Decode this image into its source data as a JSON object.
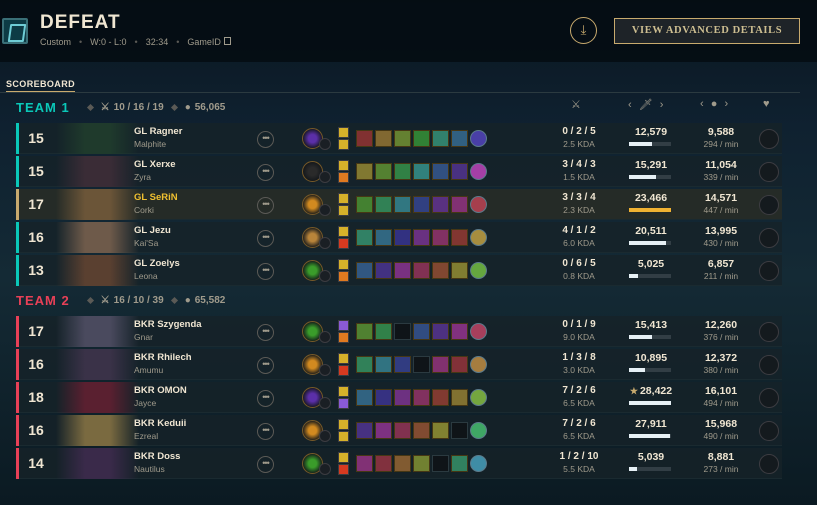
{
  "header": {
    "title": "DEFEAT",
    "queue": "Custom",
    "record": "W:0 - L:0",
    "duration": "32:34",
    "game_id_label": "GameID",
    "download_icon": "download-icon",
    "advanced_button": "VIEW ADVANCED DETAILS"
  },
  "tab": {
    "label": "SCOREBOARD"
  },
  "colors": {
    "team1": "#0ac8b9",
    "team2": "#e84057",
    "accent": "#c8aa6e",
    "text": "#f0e6d2",
    "muted": "#a09b8c"
  },
  "columns": {
    "kda_icon": "crossed-swords-icon",
    "damage_icon": "sword-icon",
    "gold_icon": "gold-coins-icon",
    "honor_icon": "heart-icon",
    "nav_left": "‹",
    "nav_right": "›"
  },
  "teams": [
    {
      "name": "TEAM 1",
      "kda": "10 / 16 / 19",
      "gold": "56,065",
      "players": [
        {
          "level": "15",
          "player": "GL Ragner",
          "champion": "Malphite",
          "kda": "0 / 2 / 5",
          "kda_ratio": "2.5 KDA",
          "damage": "12,579",
          "damage_share": 0.54,
          "gold": "9,588",
          "gpm": "294 / min",
          "highlight": false,
          "mvp": false,
          "items": [
            1,
            1,
            1,
            1,
            1,
            1,
            1
          ],
          "champ_color": "#1f3a2c",
          "rune_color": "#5b2fa8",
          "spell_colors": [
            "#d6b12a",
            "#d6b12a"
          ]
        },
        {
          "level": "15",
          "player": "GL Xerxe",
          "champion": "Zyra",
          "kda": "3 / 4 / 3",
          "kda_ratio": "1.5 KDA",
          "damage": "15,291",
          "damage_share": 0.65,
          "gold": "11,054",
          "gpm": "339 / min",
          "highlight": false,
          "mvp": false,
          "items": [
            1,
            1,
            1,
            1,
            1,
            1,
            1
          ],
          "champ_color": "#3a2c36",
          "rune_color": "#2a2a2a",
          "spell_colors": [
            "#d6b12a",
            "#e07a20"
          ]
        },
        {
          "level": "17",
          "player": "GL SeRiN",
          "champion": "Corki",
          "kda": "3 / 3 / 4",
          "kda_ratio": "2.3 KDA",
          "damage": "23,466",
          "damage_share": 1.0,
          "gold": "14,571",
          "gpm": "447 / min",
          "highlight": true,
          "mvp": false,
          "items": [
            1,
            1,
            1,
            1,
            1,
            1,
            1
          ],
          "champ_color": "#6b5538",
          "rune_color": "#d28a20",
          "spell_colors": [
            "#d6b12a",
            "#d6b12a"
          ]
        },
        {
          "level": "16",
          "player": "GL Jezu",
          "champion": "Kai'Sa",
          "kda": "4 / 1 / 2",
          "kda_ratio": "6.0 KDA",
          "damage": "20,511",
          "damage_share": 0.87,
          "gold": "13,995",
          "gpm": "430 / min",
          "highlight": false,
          "mvp": false,
          "items": [
            1,
            1,
            1,
            1,
            1,
            1,
            1
          ],
          "champ_color": "#6e5a4a",
          "rune_color": "#b8843a",
          "spell_colors": [
            "#d6b12a",
            "#d63a20"
          ]
        },
        {
          "level": "13",
          "player": "GL Zoelys",
          "champion": "Leona",
          "kda": "0 / 6 / 5",
          "kda_ratio": "0.8 KDA",
          "damage": "5,025",
          "damage_share": 0.21,
          "gold": "6,857",
          "gpm": "211 / min",
          "highlight": false,
          "mvp": false,
          "items": [
            1,
            1,
            1,
            1,
            1,
            1,
            1
          ],
          "champ_color": "#5a4030",
          "rune_color": "#3a9c2a",
          "spell_colors": [
            "#d6b12a",
            "#e07a20"
          ]
        }
      ]
    },
    {
      "name": "TEAM 2",
      "kda": "16 / 10 / 39",
      "gold": "65,582",
      "players": [
        {
          "level": "17",
          "player": "BKR Szygenda",
          "champion": "Gnar",
          "kda": "0 / 1 / 9",
          "kda_ratio": "9.0 KDA",
          "damage": "15,413",
          "damage_share": 0.54,
          "gold": "12,260",
          "gpm": "376 / min",
          "highlight": false,
          "mvp": false,
          "items": [
            1,
            1,
            0,
            1,
            1,
            1,
            1
          ],
          "champ_color": "#4a4a5e",
          "rune_color": "#3a9c2a",
          "spell_colors": [
            "#8a5ad6",
            "#e07a20"
          ]
        },
        {
          "level": "16",
          "player": "BKR Rhilech",
          "champion": "Amumu",
          "kda": "1 / 3 / 8",
          "kda_ratio": "3.0 KDA",
          "damage": "10,895",
          "damage_share": 0.38,
          "gold": "12,372",
          "gpm": "380 / min",
          "highlight": false,
          "mvp": false,
          "items": [
            1,
            1,
            1,
            0,
            1,
            1,
            1
          ],
          "champ_color": "#3a3248",
          "rune_color": "#d28a20",
          "spell_colors": [
            "#d6b12a",
            "#d63a20"
          ]
        },
        {
          "level": "18",
          "player": "BKR OMON",
          "champion": "Jayce",
          "kda": "7 / 2 / 6",
          "kda_ratio": "6.5 KDA",
          "damage": "28,422",
          "damage_share": 1.0,
          "gold": "16,101",
          "gpm": "494 / min",
          "highlight": false,
          "mvp": true,
          "items": [
            1,
            1,
            1,
            1,
            1,
            1,
            1
          ],
          "champ_color": "#5a2030",
          "rune_color": "#5b2fa8",
          "spell_colors": [
            "#d6b12a",
            "#8a5ad6"
          ]
        },
        {
          "level": "16",
          "player": "BKR Keduii",
          "champion": "Ezreal",
          "kda": "7 / 2 / 6",
          "kda_ratio": "6.5 KDA",
          "damage": "27,911",
          "damage_share": 0.98,
          "gold": "15,968",
          "gpm": "490 / min",
          "highlight": false,
          "mvp": false,
          "items": [
            1,
            1,
            1,
            1,
            1,
            0,
            1
          ],
          "champ_color": "#7a6a40",
          "rune_color": "#d28a20",
          "spell_colors": [
            "#d6b12a",
            "#d6b12a"
          ]
        },
        {
          "level": "14",
          "player": "BKR Doss",
          "champion": "Nautilus",
          "kda": "1 / 2 / 10",
          "kda_ratio": "5.5 KDA",
          "damage": "5,039",
          "damage_share": 0.18,
          "gold": "8,881",
          "gpm": "273 / min",
          "highlight": false,
          "mvp": false,
          "items": [
            1,
            1,
            1,
            1,
            0,
            1,
            1
          ],
          "champ_color": "#3a2a4a",
          "rune_color": "#3a9c2a",
          "spell_colors": [
            "#d6b12a",
            "#d63a20"
          ]
        }
      ]
    }
  ]
}
